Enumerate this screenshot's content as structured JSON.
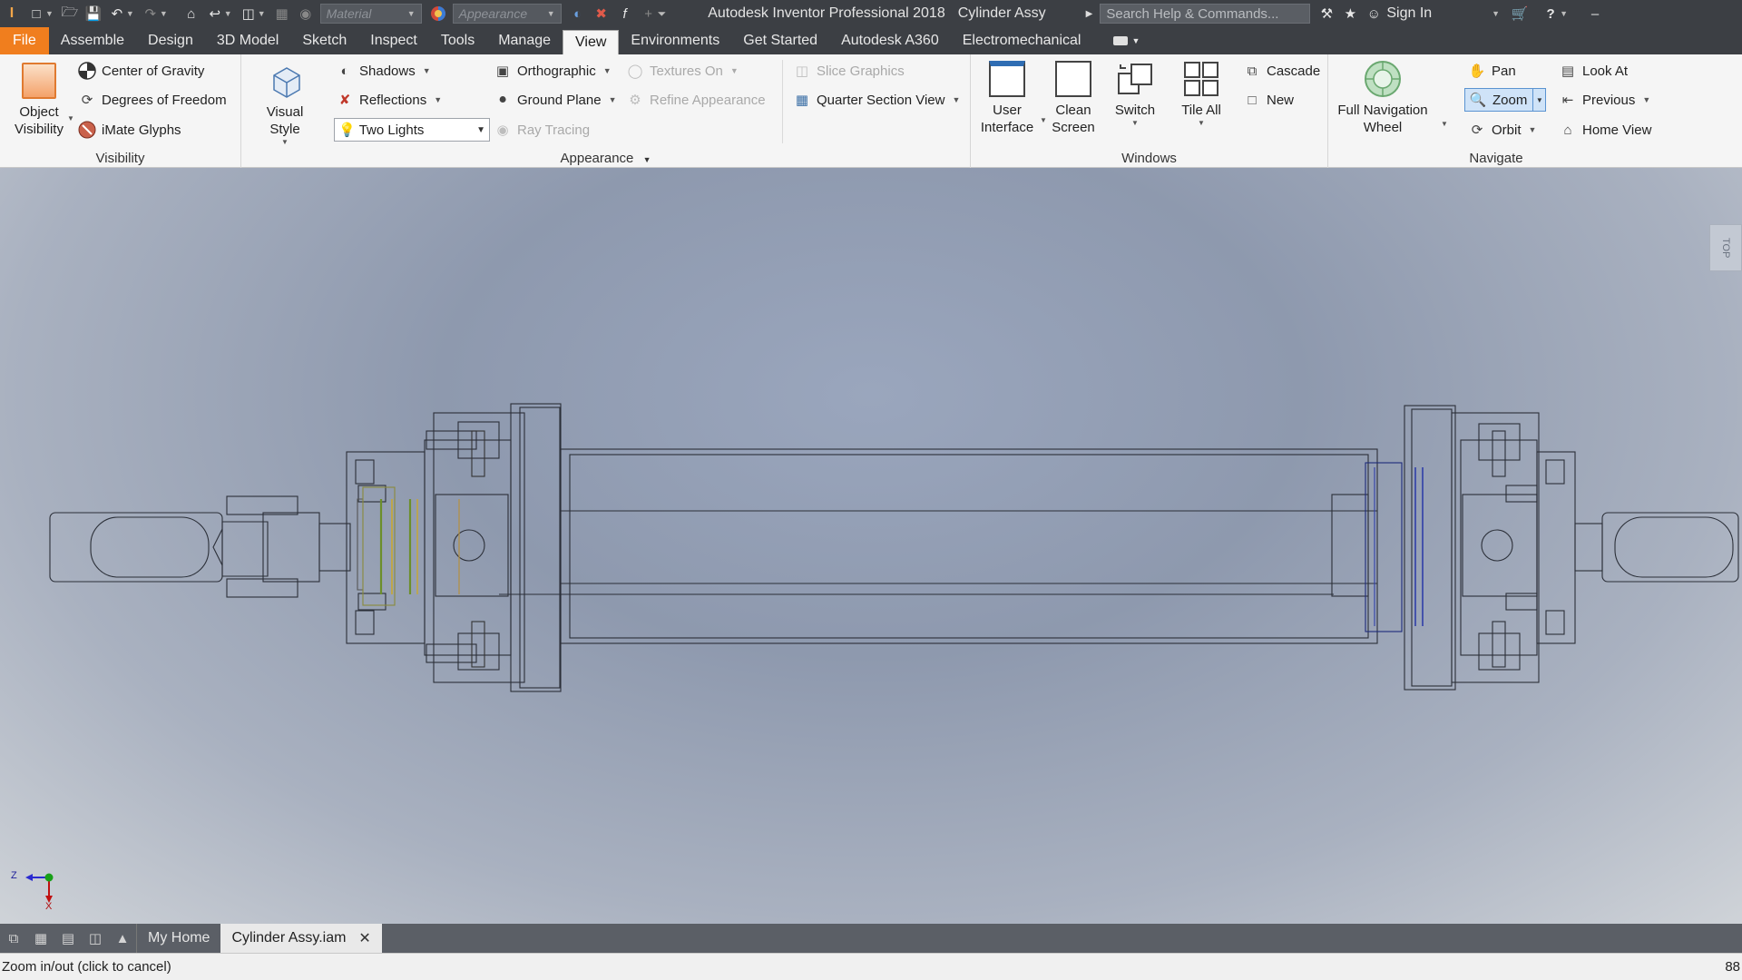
{
  "titlebar": {
    "app_logo": "I PRO",
    "material_placeholder": "Material",
    "appearance_placeholder": "Appearance",
    "app_title": "Autodesk Inventor Professional 2018",
    "doc_title": "Cylinder Assy",
    "search_placeholder": "Search Help & Commands...",
    "sign_in": "Sign In"
  },
  "tabs": [
    "File",
    "Assemble",
    "Design",
    "3D Model",
    "Sketch",
    "Inspect",
    "Tools",
    "Manage",
    "View",
    "Environments",
    "Get Started",
    "Autodesk A360",
    "Electromechanical"
  ],
  "active_tab": "View",
  "ribbon": {
    "visibility": {
      "title": "Visibility",
      "object_visibility": "Object Visibility",
      "center_of_gravity": "Center of Gravity",
      "degrees_of_freedom": "Degrees of Freedom",
      "imate_glyphs": "iMate Glyphs"
    },
    "appearance": {
      "title": "Appearance",
      "visual_style": "Visual Style",
      "shadows": "Shadows",
      "reflections": "Reflections",
      "lighting": "Two Lights",
      "orthographic": "Orthographic",
      "ground_plane": "Ground Plane",
      "textures_on": "Textures On",
      "refine_appearance": "Refine Appearance",
      "ray_tracing": "Ray Tracing",
      "slice_graphics": "Slice Graphics",
      "quarter_section_view": "Quarter Section View"
    },
    "windows": {
      "title": "Windows",
      "user_interface": "User Interface",
      "clean_screen": "Clean Screen",
      "switch": "Switch",
      "tile_all": "Tile All",
      "cascade": "Cascade",
      "new": "New"
    },
    "navigate": {
      "title": "Navigate",
      "full_navigation_wheel": "Full Navigation Wheel",
      "pan": "Pan",
      "zoom": "Zoom",
      "orbit": "Orbit",
      "look_at": "Look At",
      "previous": "Previous",
      "home_view": "Home View"
    }
  },
  "viewcube_label": "TOP",
  "axis": {
    "z": "Z",
    "x": "X"
  },
  "doc_tabs": {
    "home": "My Home",
    "active": "Cylinder Assy.iam"
  },
  "status": {
    "message": "Zoom in/out (click to cancel)",
    "count": "88"
  }
}
